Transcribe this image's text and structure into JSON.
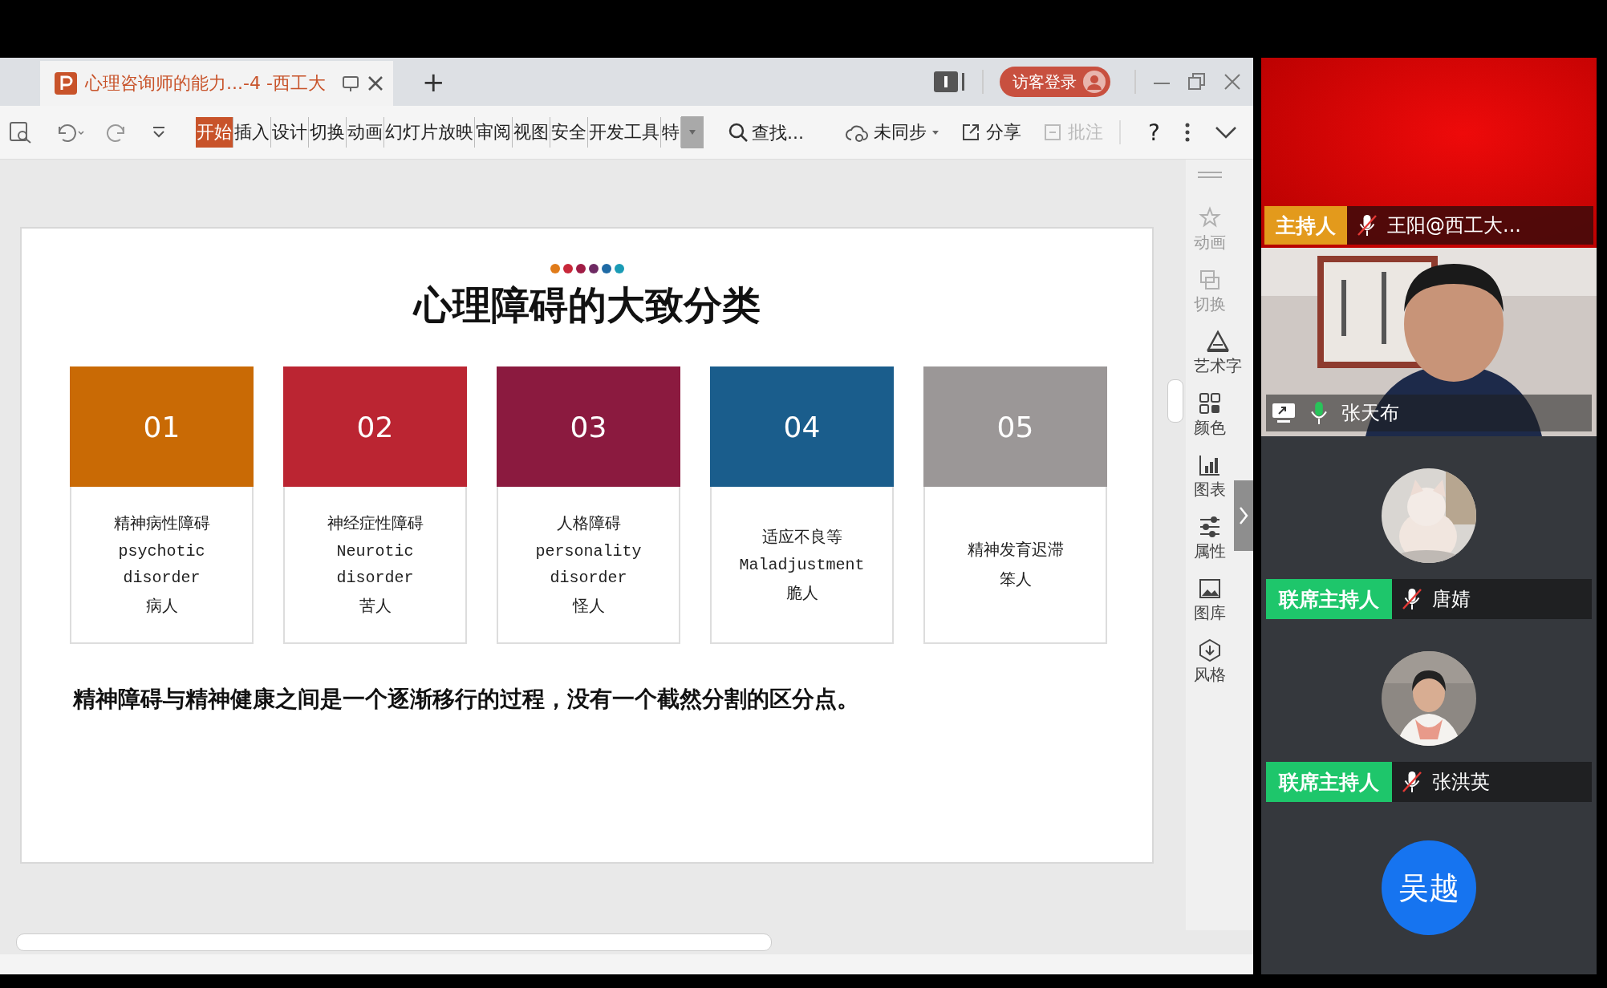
{
  "document_tab": {
    "title": "心理咨询师的能力...-4 -西工大"
  },
  "new_tab": "+",
  "guest_login": "访客登录",
  "ribbon_tabs": [
    {
      "label": "开始",
      "selected": true
    },
    {
      "label": "插入",
      "selected": false
    },
    {
      "label": "设计",
      "selected": false
    },
    {
      "label": "切换",
      "selected": false
    },
    {
      "label": "动画",
      "selected": false
    },
    {
      "label": "幻灯片放映",
      "selected": false
    },
    {
      "label": "审阅",
      "selected": false
    },
    {
      "label": "视图",
      "selected": false
    },
    {
      "label": "安全",
      "selected": false
    },
    {
      "label": "开发工具",
      "selected": false
    },
    {
      "label": "特",
      "selected": false
    }
  ],
  "search": {
    "placeholder": "查找..."
  },
  "sync": "未同步",
  "share": "分享",
  "comment": {
    "label": "批注",
    "disabled": true
  },
  "help": "?",
  "slide": {
    "title": "心理障碍的大致分类",
    "dots": [
      {
        "color": "#e07b1a"
      },
      {
        "color": "#c8283a"
      },
      {
        "color": "#a01c45"
      },
      {
        "color": "#6e2a63"
      },
      {
        "color": "#1f6aa5"
      },
      {
        "color": "#1a9bb5"
      }
    ],
    "cards": [
      {
        "number": "01",
        "color": "#c96a05",
        "lines": [
          "精神病性障碍",
          "psychotic",
          "disorder",
          "病人"
        ]
      },
      {
        "number": "02",
        "color": "#bb2532",
        "lines": [
          "神经症性障碍",
          "Neurotic",
          "disorder",
          "苦人"
        ]
      },
      {
        "number": "03",
        "color": "#8b1a3f",
        "lines": [
          "人格障碍",
          "personality",
          "disorder",
          "怪人"
        ]
      },
      {
        "number": "04",
        "color": "#1a5d8c",
        "lines": [
          "适应不良等",
          "Maladjustment",
          "脆人"
        ]
      },
      {
        "number": "05",
        "color": "#9b9797",
        "lines": [
          "精神发育迟滞",
          "笨人"
        ]
      }
    ],
    "note": "精神障碍与精神健康之间是一个逐渐移行的过程，没有一个截然分割的区分点。"
  },
  "side_panel": [
    {
      "label": "动画",
      "kind": "animation",
      "disabled": true
    },
    {
      "label": "切换",
      "kind": "transition",
      "disabled": true
    },
    {
      "label": "艺术字",
      "kind": "wordart",
      "disabled": false
    },
    {
      "label": "颜色",
      "kind": "color",
      "disabled": false
    },
    {
      "label": "图表",
      "kind": "chart",
      "disabled": false
    },
    {
      "label": "属性",
      "kind": "properties",
      "disabled": false
    },
    {
      "label": "图库",
      "kind": "gallery",
      "disabled": false
    },
    {
      "label": "风格",
      "kind": "style",
      "disabled": false
    }
  ],
  "meeting": {
    "host": {
      "role": "主持人",
      "name": "王阳@西工大...",
      "muted": true
    },
    "speaker": {
      "name": "张天布",
      "muted": false
    },
    "participants": [
      {
        "role": "联席主持人",
        "name": "唐婧",
        "muted": true,
        "kind": "picture"
      },
      {
        "role": "联席主持人",
        "name": "张洪英",
        "muted": true,
        "kind": "picture"
      }
    ],
    "next": {
      "avatar_text": "吴越"
    }
  }
}
